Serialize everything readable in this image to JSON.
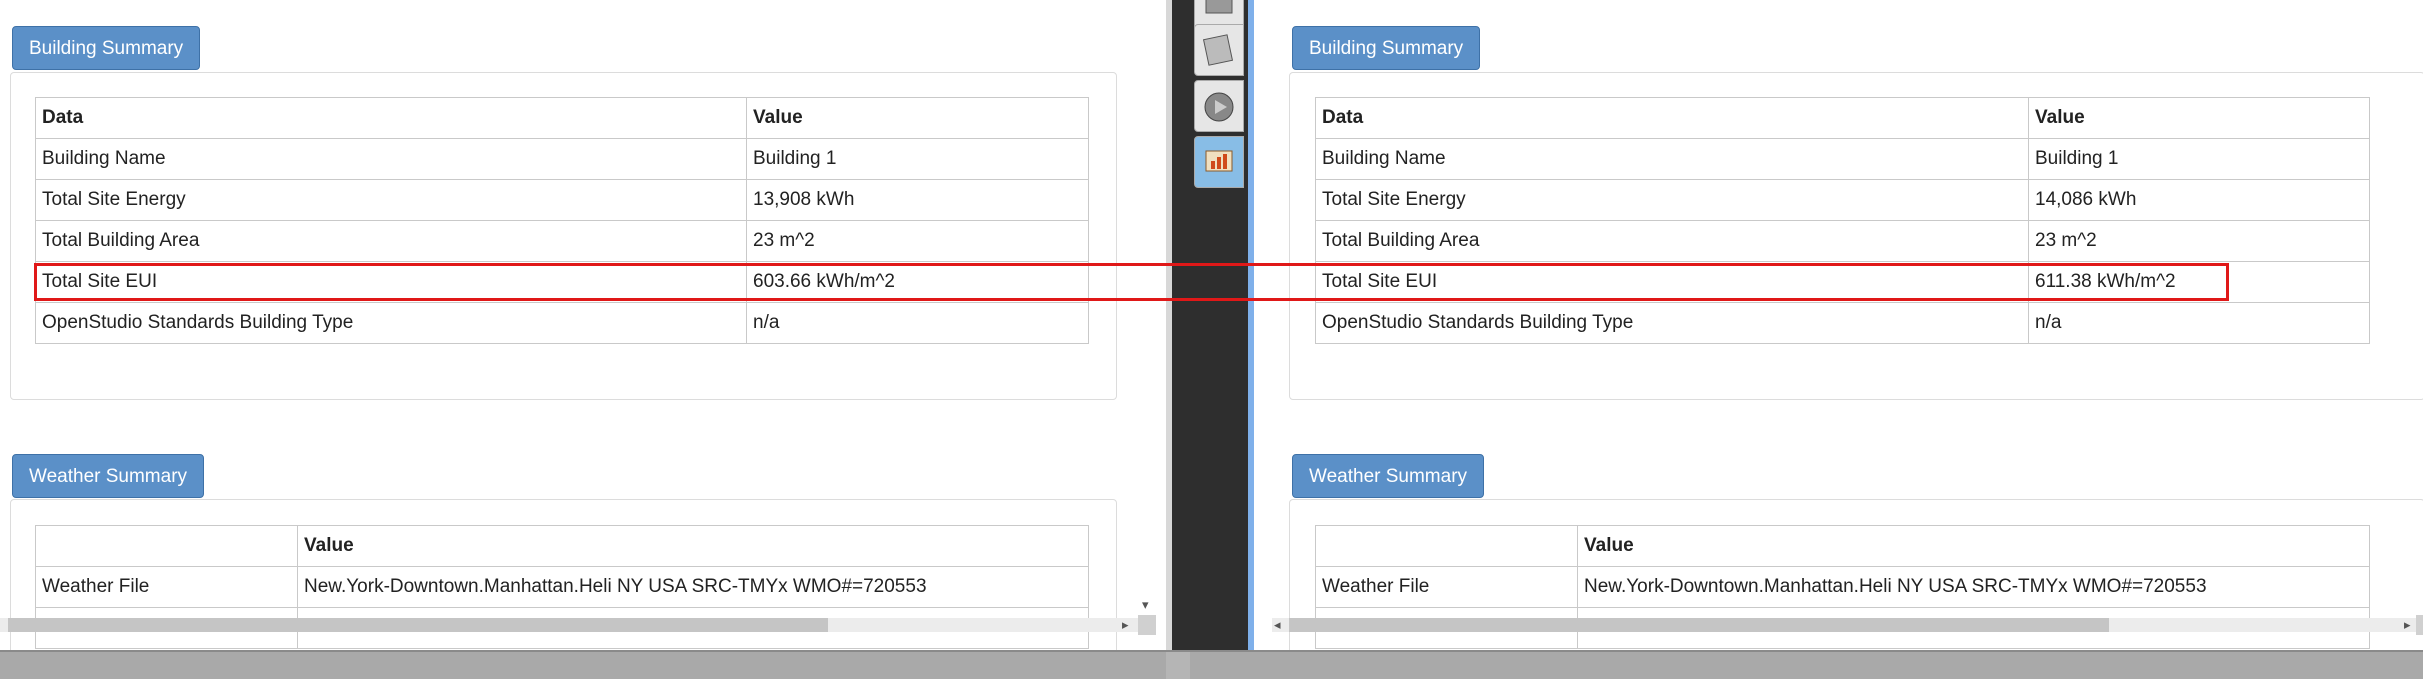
{
  "left": {
    "building_summary": {
      "button": "Building Summary",
      "headers": [
        "Data",
        "Value"
      ],
      "rows": [
        [
          "Building Name",
          "Building 1"
        ],
        [
          "Total Site Energy",
          "13,908 kWh"
        ],
        [
          "Total Building Area",
          "23 m^2"
        ],
        [
          "Total Site EUI",
          "603.66 kWh/m^2"
        ],
        [
          "OpenStudio Standards Building Type",
          "n/a"
        ]
      ]
    },
    "weather_summary": {
      "button": "Weather Summary",
      "headers": [
        "",
        "Value"
      ],
      "rows": [
        [
          "Weather File",
          "New.York-Downtown.Manhattan.Heli NY USA SRC-TMYx WMO#=720553"
        ]
      ]
    }
  },
  "right": {
    "building_summary": {
      "button": "Building Summary",
      "headers": [
        "Data",
        "Value"
      ],
      "rows": [
        [
          "Building Name",
          "Building 1"
        ],
        [
          "Total Site Energy",
          "14,086 kWh"
        ],
        [
          "Total Building Area",
          "23 m^2"
        ],
        [
          "Total Site EUI",
          "611.38 kWh/m^2"
        ],
        [
          "OpenStudio Standards Building Type",
          "n/a"
        ]
      ]
    },
    "weather_summary": {
      "button": "Weather Summary",
      "headers": [
        "",
        "Value"
      ],
      "rows": [
        [
          "Weather File",
          "New.York-Downtown.Manhattan.Heli NY USA SRC-TMYx WMO#=720553"
        ]
      ]
    }
  },
  "toolbar": {
    "icons": [
      "model-icon",
      "document-icon",
      "run-icon",
      "results-chart-icon"
    ],
    "active": "results-chart-icon"
  },
  "colors": {
    "button_bg": "#5b90c8",
    "highlight": "#e01818",
    "toolbar_bg": "#2e2e2e",
    "active_tab": "#88bde6"
  }
}
